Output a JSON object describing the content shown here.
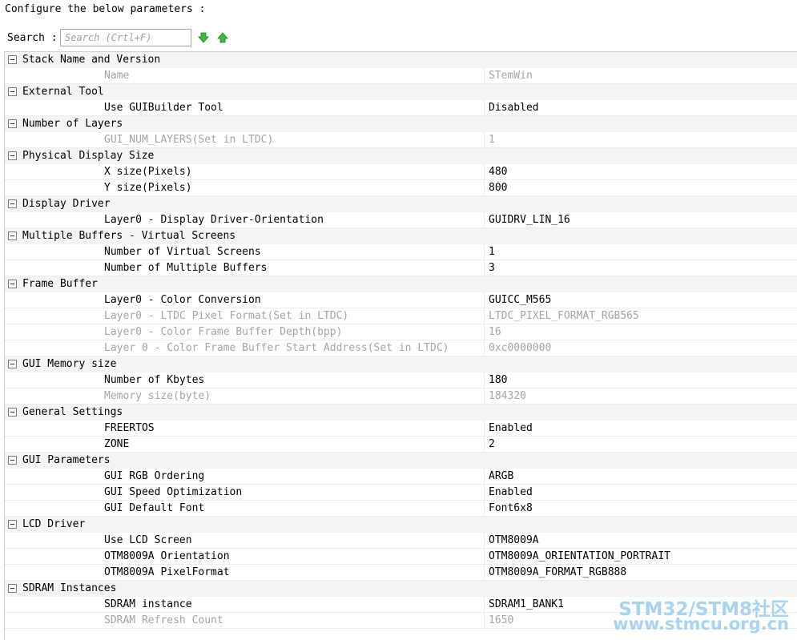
{
  "header": {
    "configure_label": "Configure the below parameters :"
  },
  "search": {
    "label": "Search :",
    "placeholder": "Search (Crtl+F)"
  },
  "colors": {
    "enabled_text": "#000000",
    "disabled_text": "#a5a5a5",
    "watermark": "#a9d4f0"
  },
  "groups": [
    {
      "name": "Stack Name and Version",
      "params": [
        {
          "name": "Name",
          "value": "STemWin",
          "disabled": true
        }
      ]
    },
    {
      "name": "External Tool",
      "params": [
        {
          "name": "Use GUIBuilder Tool",
          "value": "Disabled",
          "disabled": false
        }
      ]
    },
    {
      "name": "Number of Layers",
      "params": [
        {
          "name": "GUI_NUM_LAYERS(Set in LTDC)",
          "value": "1",
          "disabled": true
        }
      ]
    },
    {
      "name": "Physical Display Size",
      "params": [
        {
          "name": "X size(Pixels)",
          "value": "480",
          "disabled": false
        },
        {
          "name": "Y size(Pixels)",
          "value": "800",
          "disabled": false
        }
      ]
    },
    {
      "name": "Display Driver",
      "params": [
        {
          "name": "Layer0 - Display Driver-Orientation",
          "value": "GUIDRV_LIN_16",
          "disabled": false
        }
      ]
    },
    {
      "name": "Multiple Buffers - Virtual Screens",
      "params": [
        {
          "name": "Number of Virtual Screens",
          "value": "1",
          "disabled": false
        },
        {
          "name": "Number of Multiple Buffers",
          "value": "3",
          "disabled": false
        }
      ]
    },
    {
      "name": "Frame Buffer",
      "params": [
        {
          "name": "Layer0 - Color Conversion",
          "value": "GUICC_M565",
          "disabled": false
        },
        {
          "name": "Layer0 - LTDC Pixel Format(Set in LTDC)",
          "value": "LTDC_PIXEL_FORMAT_RGB565",
          "disabled": true
        },
        {
          "name": "Layer0 - Color Frame Buffer Depth(bpp)",
          "value": "16",
          "disabled": true
        },
        {
          "name": "Layer 0 - Color Frame Buffer Start Address(Set in LTDC)",
          "value": "0xc0000000",
          "disabled": true
        }
      ]
    },
    {
      "name": "GUI Memory size",
      "params": [
        {
          "name": "Number of Kbytes",
          "value": "180",
          "disabled": false
        },
        {
          "name": "Memory size(byte)",
          "value": "184320",
          "disabled": true
        }
      ]
    },
    {
      "name": "General Settings",
      "params": [
        {
          "name": "FREERTOS",
          "value": "Enabled",
          "disabled": false
        },
        {
          "name": "ZONE",
          "value": "2",
          "disabled": false
        }
      ]
    },
    {
      "name": "GUI Parameters",
      "params": [
        {
          "name": "GUI RGB Ordering",
          "value": "ARGB",
          "disabled": false
        },
        {
          "name": "GUI Speed Optimization",
          "value": "Enabled",
          "disabled": false
        },
        {
          "name": "GUI Default Font",
          "value": "Font6x8",
          "disabled": false
        }
      ]
    },
    {
      "name": "LCD Driver",
      "params": [
        {
          "name": "Use LCD Screen",
          "value": "OTM8009A",
          "disabled": false
        },
        {
          "name": "OTM8009A Orientation",
          "value": "OTM8009A_ORIENTATION_PORTRAIT",
          "disabled": false
        },
        {
          "name": "OTM8009A PixelFormat",
          "value": "OTM8009A_FORMAT_RGB888",
          "disabled": false
        }
      ]
    },
    {
      "name": "SDRAM Instances",
      "params": [
        {
          "name": "SDRAM instance",
          "value": "SDRAM1_BANK1",
          "disabled": false
        },
        {
          "name": "SDRAM Refresh Count",
          "value": "1650",
          "disabled": true
        }
      ]
    }
  ],
  "watermark": {
    "line1": "STM32/STM8社区",
    "line2": "www.stmcu.org.cn"
  }
}
